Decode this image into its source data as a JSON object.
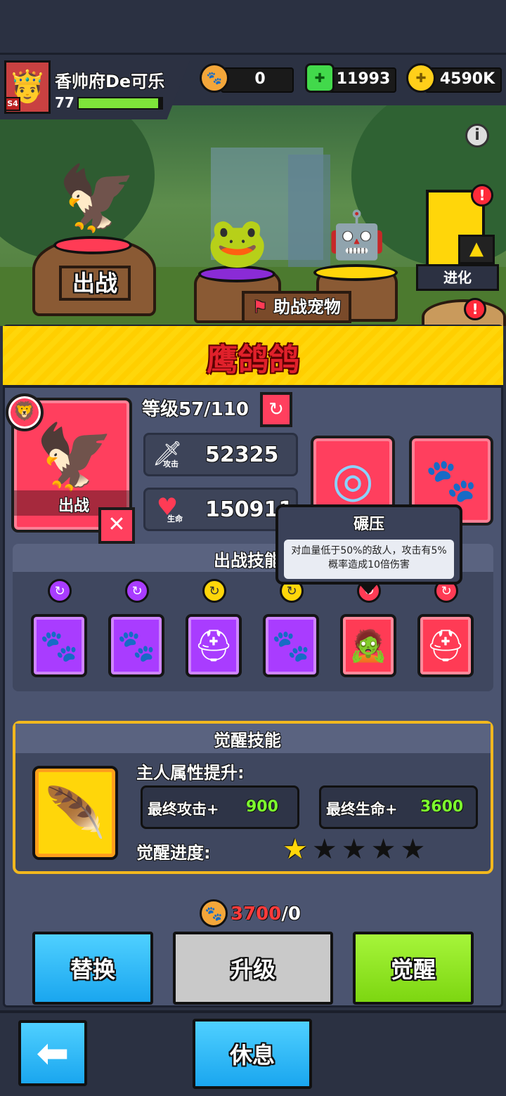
{
  "player": {
    "name": "香帅府De可乐",
    "level": "77",
    "badge": "S4",
    "xp_fraction": 0.96
  },
  "currencies": [
    {
      "name": "paw-coin",
      "value": "0"
    },
    {
      "name": "gem",
      "value": "11993"
    },
    {
      "name": "gold",
      "value": "4590K"
    }
  ],
  "scene": {
    "battle_label": "出战",
    "assist_label": "助战宠物",
    "evolve_label": "进化"
  },
  "pet": {
    "name": "鹰鸽鸽",
    "level_text": "等级57/110",
    "card_label": "出战",
    "attack_tag": "攻击",
    "attack_value": "52325",
    "hp_tag": "生命",
    "hp_value": "150911"
  },
  "tooltip": {
    "title": "碾压",
    "desc": "对血量低于50%的敌人，攻击有5%概率造成10倍伤害"
  },
  "battle_skills": {
    "title": "出战技能",
    "dots": [
      "purple",
      "purple",
      "yellow",
      "yellow",
      "red",
      "red"
    ]
  },
  "awaken": {
    "title": "觉醒技能",
    "owner_boost": "主人属性提升:",
    "attack_label": "最终攻击+",
    "attack_value": "900",
    "hp_label": "最终生命+",
    "hp_value": "3600",
    "progress_label": "觉醒进度:",
    "stars_filled": 1,
    "stars_total": 5
  },
  "cost": {
    "current": "3700",
    "separator": "/",
    "owned": "0"
  },
  "buttons": {
    "replace": "替换",
    "upgrade": "升级",
    "awaken": "觉醒",
    "rest": "休息"
  },
  "colors": {
    "yellow_banner": "#ffd60a",
    "red_card": "#ff3f5e",
    "purple_tile": "#a93cff",
    "green_value": "#7dff2e",
    "blue_button": "#25b8ff",
    "green_button": "#8de81a",
    "gray_button": "#c9c9c9"
  }
}
